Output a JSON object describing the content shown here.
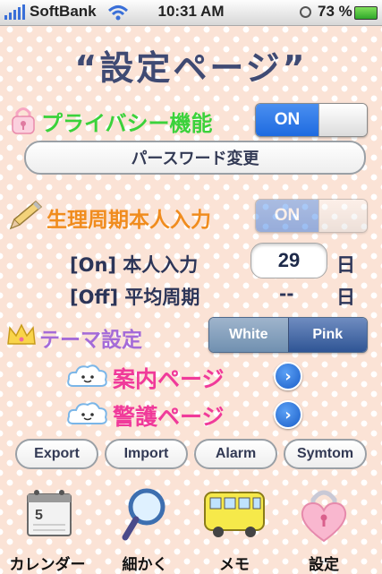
{
  "status_bar": {
    "carrier": "SoftBank",
    "time": "10:31 AM",
    "battery": "73 %"
  },
  "page_title": "“設定ページ”",
  "privacy": {
    "label": "プライバシー機能",
    "toggle": "ON",
    "toggle_state": "on"
  },
  "password_button": "パースワード変更",
  "cycle_input": {
    "label": "生理周期本人入力",
    "toggle": "ON",
    "toggle_state": "on (disabled)"
  },
  "on_row": {
    "label": "[On] 本人入力",
    "value": "29",
    "unit": "日"
  },
  "off_row": {
    "label": "[Off] 平均周期",
    "value": "--",
    "unit": "日"
  },
  "theme": {
    "label": "テーマ設定",
    "options": [
      "White",
      "Pink"
    ],
    "selected": "Pink"
  },
  "guide_page": "案内ページ",
  "security_page": "警護ページ",
  "actions": [
    "Export",
    "Import",
    "Alarm",
    "Symtom"
  ],
  "tabs": [
    {
      "label": "カレンダー",
      "icon": "calendar-icon"
    },
    {
      "label": "細かく",
      "icon": "magnifier-icon"
    },
    {
      "label": "メモ",
      "icon": "bus-icon"
    },
    {
      "label": "設定",
      "icon": "heart-lock-icon"
    }
  ],
  "colors": {
    "background": "#fbe3d6",
    "toggle_blue": "#1e6be0",
    "title": "#3f4a73",
    "privacy_label": "#3bd23b",
    "cycle_label": "#f08c1e",
    "theme_label": "#a46bd8",
    "page_link": "#f03a9a"
  }
}
